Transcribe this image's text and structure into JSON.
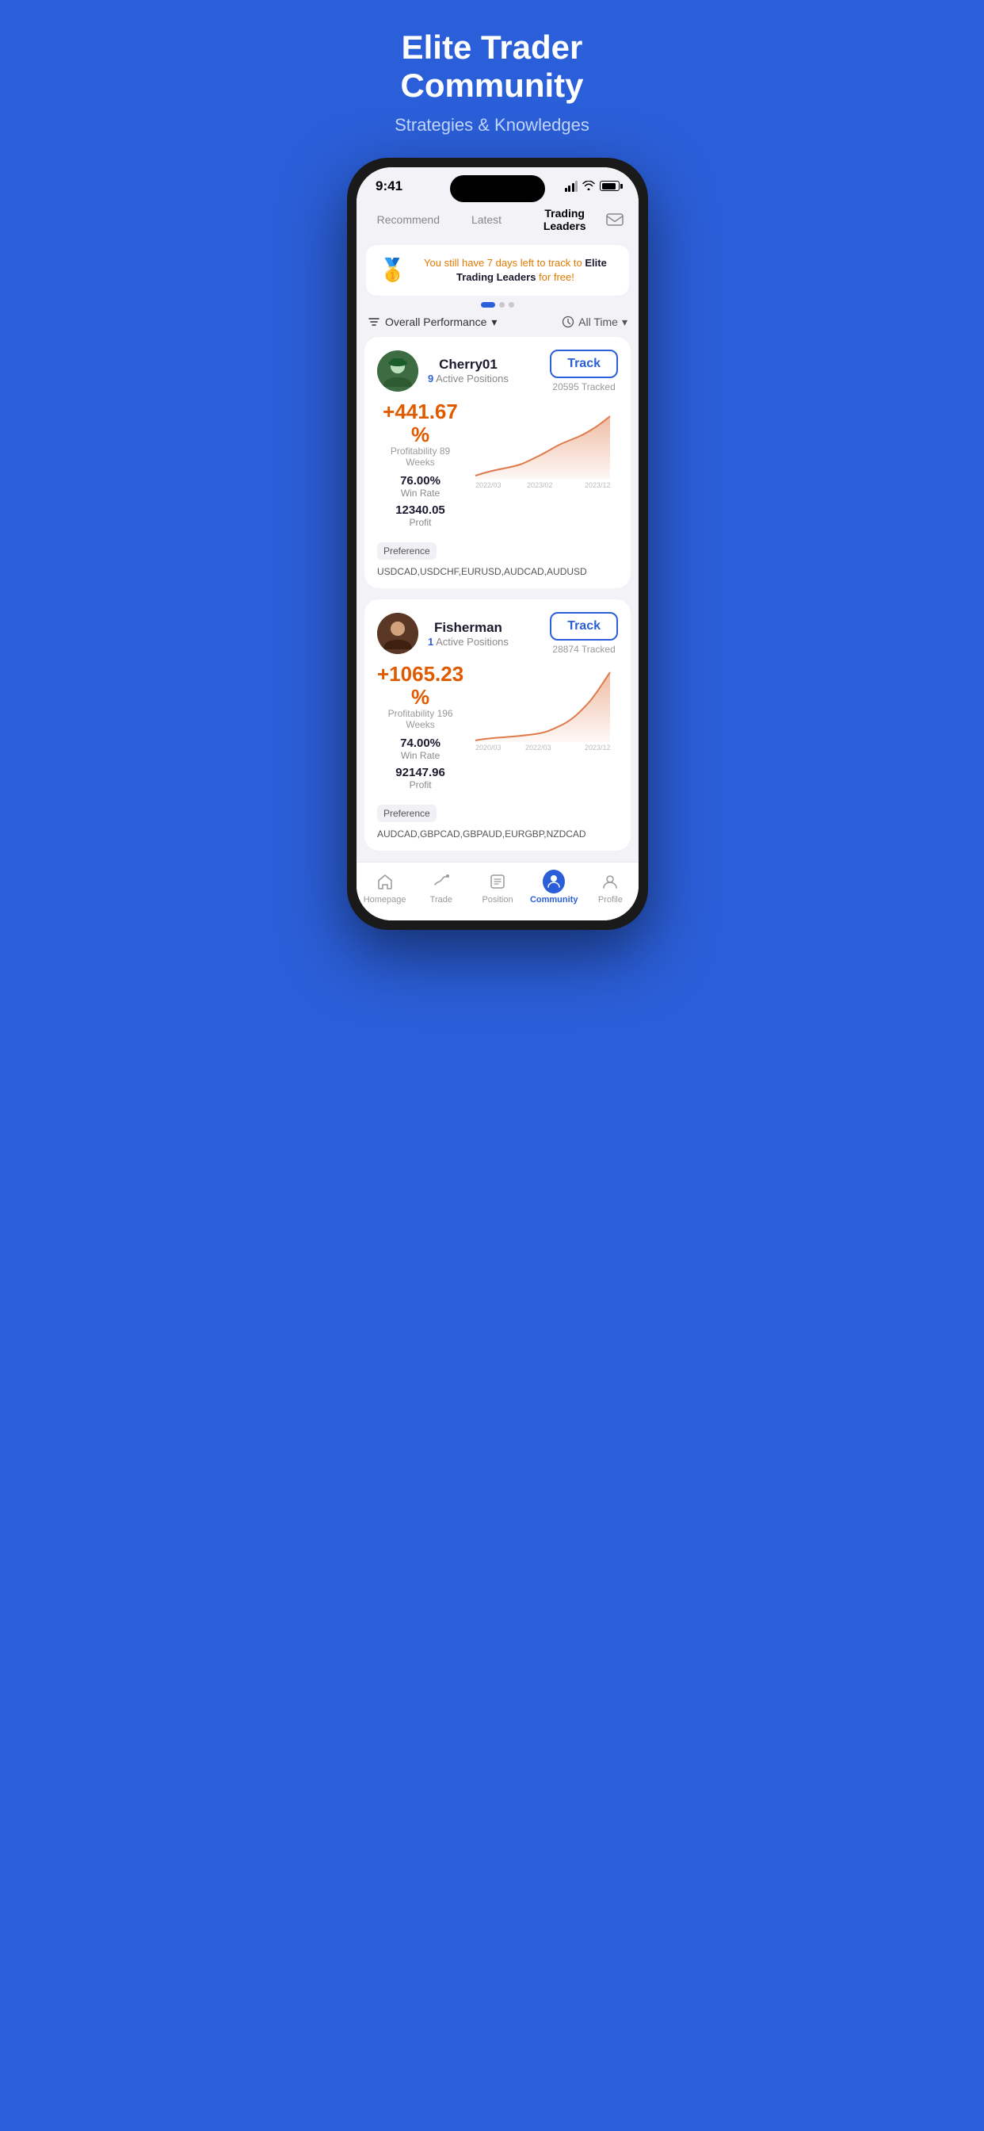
{
  "hero": {
    "title": "Elite Trader\nCommunity",
    "subtitle": "Strategies & Knowledges"
  },
  "status_bar": {
    "time": "9:41",
    "battery_pct": 85
  },
  "nav_tabs": [
    {
      "id": "recommend",
      "label": "Recommend",
      "active": false
    },
    {
      "id": "latest",
      "label": "Latest",
      "active": false
    },
    {
      "id": "trading_leaders",
      "label": "Trading Leaders",
      "active": true
    }
  ],
  "banner": {
    "emoji": "🥇",
    "text_orange": "You still have 7 days left to track to",
    "text_bold": " Elite Trading Leaders",
    "text_end": " for free!"
  },
  "filter": {
    "performance_label": "Overall Performance",
    "time_label": "All Time"
  },
  "traders": [
    {
      "id": "cherry01",
      "name": "Cherry01",
      "active_positions": "9",
      "active_label": "Active Positions",
      "track_label": "Track",
      "tracked_count": "20595 Tracked",
      "profit_pct": "+441.67 %",
      "profit_weeks": "Profitability 89 Weeks",
      "win_rate": "76.00%",
      "win_rate_label": "Win Rate",
      "profit": "12340.05",
      "profit_label": "Profit",
      "preference_label": "Preference",
      "preferences": "USDCAD,USDCHF,EURUSD,AUDCAD,AUDUSD",
      "chart_dates": [
        "2022/03",
        "2023/02",
        "2023/12"
      ],
      "avatar_emoji": "🧑‍🌾"
    },
    {
      "id": "fisherman",
      "name": "Fisherman",
      "active_positions": "1",
      "active_label": "Active Positions",
      "track_label": "Track",
      "tracked_count": "28874 Tracked",
      "profit_pct": "+1065.23 %",
      "profit_weeks": "Profitability 196 Weeks",
      "win_rate": "74.00%",
      "win_rate_label": "Win Rate",
      "profit": "92147.96",
      "profit_label": "Profit",
      "preference_label": "Preference",
      "preferences": "AUDCAD,GBPCAD,GBPAUD,EURGBP,NZDCAD",
      "chart_dates": [
        "2020/03",
        "2022/03",
        "2023/12"
      ],
      "avatar_emoji": "🧑‍🦱"
    }
  ],
  "bottom_nav": [
    {
      "id": "homepage",
      "label": "Homepage",
      "active": false,
      "icon": "home"
    },
    {
      "id": "trade",
      "label": "Trade",
      "active": false,
      "icon": "trade"
    },
    {
      "id": "position",
      "label": "Position",
      "active": false,
      "icon": "position"
    },
    {
      "id": "community",
      "label": "Community",
      "active": true,
      "icon": "community"
    },
    {
      "id": "profile",
      "label": "Profile",
      "active": false,
      "icon": "profile"
    }
  ],
  "colors": {
    "brand_blue": "#2b5fd9",
    "profit_orange": "#e05a00",
    "bg_grey": "#f2f2f7"
  }
}
